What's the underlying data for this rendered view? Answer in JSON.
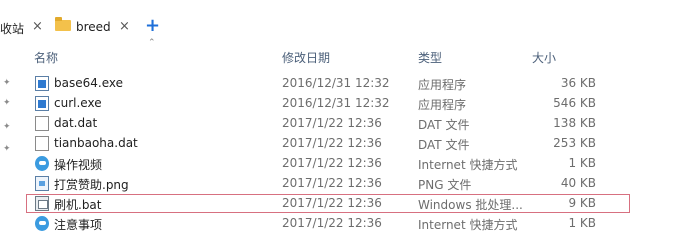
{
  "tabs": {
    "partial_label": "收站",
    "partial_close": "×",
    "active_label": "breed",
    "active_close": "×",
    "add_label": "+"
  },
  "sort_indicator": "⌃",
  "columns": {
    "name": "名称",
    "modified": "修改日期",
    "type": "类型",
    "size": "大小"
  },
  "files": [
    {
      "name": "base64.exe",
      "modified": "2016/12/31 12:32",
      "type": "应用程序",
      "size": "36 KB",
      "icon": "exe-icon"
    },
    {
      "name": "curl.exe",
      "modified": "2016/12/31 12:32",
      "type": "应用程序",
      "size": "546 KB",
      "icon": "exe-icon"
    },
    {
      "name": "dat.dat",
      "modified": "2017/1/22 12:36",
      "type": "DAT 文件",
      "size": "138 KB",
      "icon": "file-icon"
    },
    {
      "name": "tianbaoha.dat",
      "modified": "2017/1/22 12:36",
      "type": "DAT 文件",
      "size": "253 KB",
      "icon": "file-icon"
    },
    {
      "name": "操作视频",
      "modified": "2017/1/22 12:36",
      "type": "Internet 快捷方式",
      "size": "1 KB",
      "icon": "edge-icon"
    },
    {
      "name": "打赏赞助.png",
      "modified": "2017/1/22 12:36",
      "type": "PNG 文件",
      "size": "40 KB",
      "icon": "image-icon"
    },
    {
      "name": "刷机.bat",
      "modified": "2017/1/22 12:36",
      "type": "Windows 批处理...",
      "size": "9 KB",
      "icon": "bat-icon"
    },
    {
      "name": "注意事项",
      "modified": "2017/1/22 12:36",
      "type": "Internet 快捷方式",
      "size": "1 KB",
      "icon": "edge-icon"
    }
  ],
  "colors": {
    "accent": "#1e6fd9",
    "highlight_border": "#d77080",
    "header_text": "#4c607a",
    "folder": "#f3c14b"
  }
}
